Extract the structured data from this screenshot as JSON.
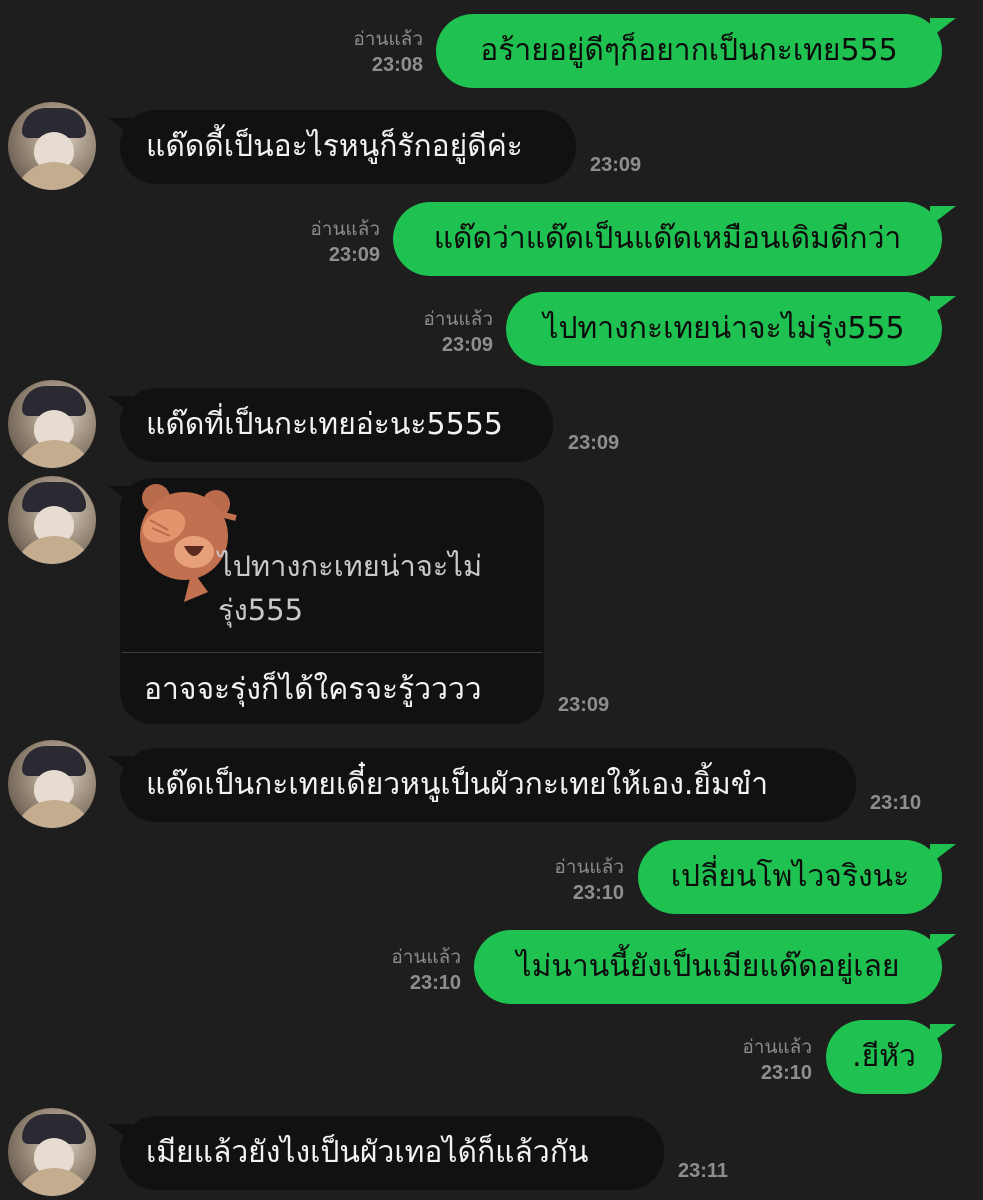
{
  "read_label": "อ่านแล้ว",
  "messages": {
    "m1": {
      "text": "อร้ายอยู่ดีๆก็อยากเป็นกะเทย555",
      "time": "23:08"
    },
    "m2": {
      "text": "แด๊ดดี้เป็นอะไรหนูก็รักอยู่ดีค่ะ",
      "time": "23:09"
    },
    "m3": {
      "text": "แด๊ดว่าแด๊ดเป็นแด๊ดเหมือนเดิมดีกว่า",
      "time": "23:09"
    },
    "m4": {
      "text": "ไปทางกะเทยน่าจะไม่รุ่ง555",
      "time": "23:09"
    },
    "m5": {
      "text": "แด๊ดที่เป็นกะเทยอ่ะนะ5555",
      "time": "23:09"
    },
    "m6": {
      "quote_line1": "ไปทางกะเทยน่าจะไม่",
      "quote_line2": "รุ่ง555",
      "text": "อาจจะรุ่งก็ได้ใครจะรู้วววว",
      "time": "23:09"
    },
    "m7": {
      "text": "แด๊ดเป็นกะเทยเดี๋ยวหนูเป็นผัวกะเทยให้เอง.ยิ้มขำ",
      "time": "23:10"
    },
    "m8": {
      "text": "เปลี่ยนโพไวจริงนะ",
      "time": "23:10"
    },
    "m9": {
      "text": "ไม่นานนี้ยังเป็นเมียแด๊ดอยู่เลย",
      "time": "23:10"
    },
    "m10": {
      "text": ".ยีหัว",
      "time": "23:10"
    },
    "m11": {
      "text": "เมียแล้วยังไงเป็นผัวเทอได้ก็แล้วกัน",
      "time": "23:11"
    }
  },
  "colors": {
    "background": "#1e1e1e",
    "outgoing_bubble": "#1fc150",
    "incoming_bubble": "#111111",
    "meta_text": "#8b8b8b"
  },
  "sticker": {
    "icon": "bear-covering-face-sticker"
  }
}
